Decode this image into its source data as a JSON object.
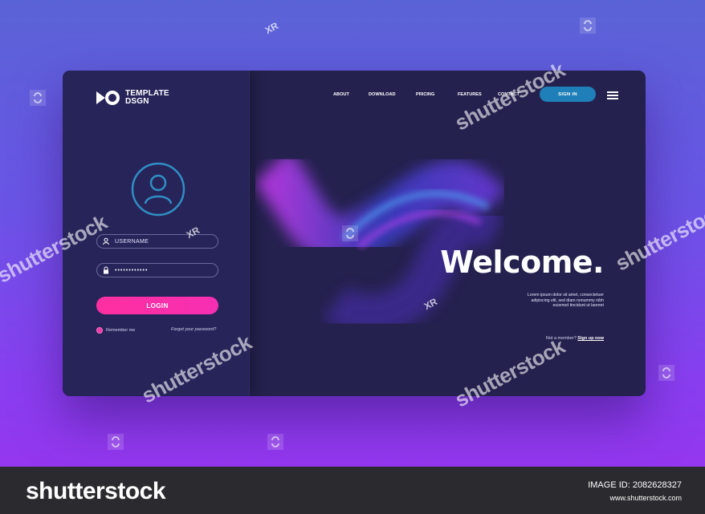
{
  "brand": {
    "line1": "TEMPLATE",
    "line2": "DSGN"
  },
  "nav": {
    "about": "ABOUT",
    "download": "DOWNLOAD",
    "pricing": "PRICING",
    "features": "FEATURES",
    "contact": "CONTACT",
    "signin": "SIGN IN"
  },
  "login": {
    "username_placeholder": "USERNAME",
    "password_value": "••••••••••••",
    "button": "LOGIN",
    "remember": "Remember me",
    "forgot": "Forgot your password?"
  },
  "hero": {
    "welcome": "Welcome.",
    "lorem": "Lorem ipsum dolor sit amet, consectetuer adipiscing elit, sed diam nonummy nibh euismod tincidunt ut laoreet",
    "not_member": "Not a member?",
    "signup": "Sign up now"
  },
  "watermark": {
    "text": "shutterstock",
    "xr": "XR"
  },
  "footer": {
    "brand": "shutterstock",
    "image_id": "IMAGE ID: 2082628327",
    "site": "www.shutterstock.com"
  },
  "colors": {
    "card": "#24214e",
    "panel": "#27245a",
    "accent_pink": "#ff2fa0",
    "accent_blue": "#1f7fb8"
  }
}
